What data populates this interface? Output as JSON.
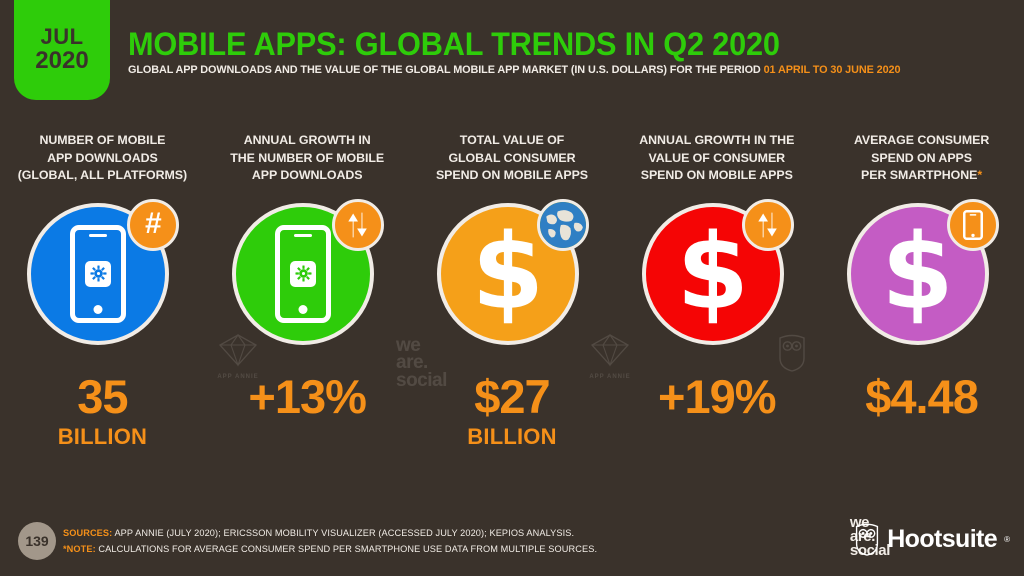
{
  "header": {
    "date_month": "JUL",
    "date_year": "2020",
    "title": "MOBILE APPS: GLOBAL TRENDS IN Q2 2020",
    "subtitle_main": "GLOBAL APP DOWNLOADS AND THE VALUE OF THE GLOBAL MOBILE APP MARKET (IN U.S. DOLLARS) FOR THE PERIOD",
    "subtitle_period": "01 APRIL TO 30 JUNE 2020"
  },
  "colors": {
    "background": "#3a322b",
    "accent_orange": "#f59019",
    "brand_green": "#2ecc0a",
    "text_cream": "#f1ece6",
    "circle_blue": "#0b7ae5",
    "circle_green": "#2ecc0a",
    "circle_orange": "#f5a019",
    "circle_red": "#f50505",
    "circle_purple": "#c45cc4"
  },
  "metrics": [
    {
      "heading_line1": "NUMBER OF MOBILE",
      "heading_line2": "APP DOWNLOADS",
      "heading_line3": "(GLOBAL, ALL PLATFORMS)",
      "circle_color": "#0b7ae5",
      "main_icon": "smartphone-app-icon",
      "badge_icon": "hashtag-icon",
      "badge_glyph": "#",
      "value": "35",
      "unit": "BILLION"
    },
    {
      "heading_line1": "ANNUAL GROWTH IN",
      "heading_line2": "THE NUMBER OF MOBILE",
      "heading_line3": "APP DOWNLOADS",
      "circle_color": "#2ecc0a",
      "main_icon": "smartphone-app-icon",
      "badge_icon": "up-down-arrows-icon",
      "badge_glyph": "",
      "value": "+13%",
      "unit": ""
    },
    {
      "heading_line1": "TOTAL VALUE OF",
      "heading_line2": "GLOBAL CONSUMER",
      "heading_line3": "SPEND ON MOBILE APPS",
      "circle_color": "#f5a019",
      "main_icon": "dollar-sign-icon",
      "badge_icon": "globe-icon",
      "badge_glyph": "",
      "value": "$27",
      "unit": "BILLION"
    },
    {
      "heading_line1": "ANNUAL GROWTH IN THE",
      "heading_line2": "VALUE OF CONSUMER",
      "heading_line3": "SPEND ON MOBILE APPS",
      "circle_color": "#f50505",
      "main_icon": "dollar-sign-icon",
      "badge_icon": "up-down-arrows-icon",
      "badge_glyph": "",
      "value": "+19%",
      "unit": ""
    },
    {
      "heading_line1": "AVERAGE CONSUMER",
      "heading_line2": "SPEND ON APPS",
      "heading_line3": "PER SMARTPHONE",
      "heading_line3_star": "*",
      "circle_color": "#c45cc4",
      "main_icon": "dollar-sign-icon",
      "badge_icon": "smartphone-icon",
      "badge_glyph": "",
      "value": "$4.48",
      "unit": ""
    }
  ],
  "watermarks": {
    "app_annie": "APP ANNIE",
    "we_are_social_l1": "we",
    "we_are_social_l2": "are.",
    "we_are_social_l3": "social"
  },
  "footer": {
    "page_number": "139",
    "sources_label": "SOURCES:",
    "sources_text": "APP ANNIE (JULY 2020); ERICSSON MOBILITY VISUALIZER (ACCESSED JULY 2020); KEPIOS ANALYSIS.",
    "note_label": "*NOTE:",
    "note_text": "CALCULATIONS FOR AVERAGE CONSUMER SPEND PER SMARTPHONE USE DATA FROM MULTIPLE SOURCES.",
    "was_l1": "we",
    "was_l2": "are.",
    "was_l3": "social",
    "hootsuite_name": "Hootsuite",
    "hootsuite_reg": "®"
  }
}
